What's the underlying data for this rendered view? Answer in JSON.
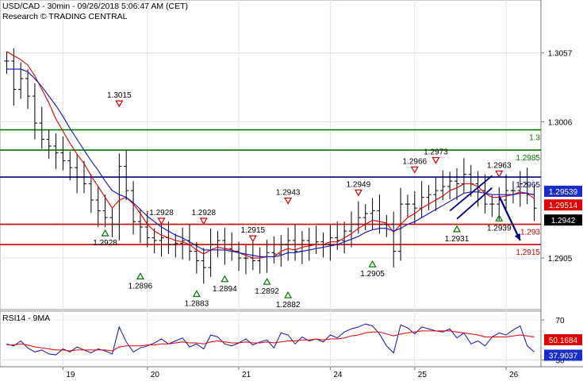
{
  "header": {
    "title": "USD/CAD - 30min - 09/26/2018 5:06:47 AM (CET)",
    "subtitle": "Research © TRADING CENTRAL"
  },
  "colors": {
    "price": "#000000",
    "ma_red": "#e00000",
    "ma_blue": "#1010c0",
    "support": "#cc0000",
    "resistance": "#007700",
    "pivot": "#000080",
    "box_red": "#e00000",
    "box_blue": "#1a2cc8",
    "box_black": "#000000"
  },
  "chart_data": [
    {
      "type": "line",
      "name": "price-panel",
      "ylim": [
        1.2868,
        1.3088
      ],
      "y_ticks": [
        "1.3057",
        "1.3006",
        "1.2905"
      ],
      "y_tick_values": [
        1.3057,
        1.3006,
        1.2905
      ],
      "x_ticks": [
        "19",
        "20",
        "21",
        "24",
        "25",
        "26"
      ],
      "x_tick_index": [
        8,
        20,
        33,
        46,
        58,
        71
      ],
      "n_bars": 76,
      "series": [],
      "close": [
        1.3051,
        1.303,
        1.3038,
        1.3025,
        1.3005,
        1.2993,
        1.2988,
        1.2983,
        1.2977,
        1.2972,
        1.2965,
        1.296,
        1.2948,
        1.294,
        1.2935,
        1.293,
        1.2973,
        1.2955,
        1.2932,
        1.2928,
        1.292,
        1.2918,
        1.292,
        1.2915,
        1.2916,
        1.2918,
        1.291,
        1.2903,
        1.2898,
        1.2915,
        1.2918,
        1.2912,
        1.291,
        1.2905,
        1.2905,
        1.2903,
        1.2906,
        1.2909,
        1.2908,
        1.2915,
        1.2918,
        1.291,
        1.2918,
        1.2915,
        1.2917,
        1.2915,
        1.292,
        1.2918,
        1.2925,
        1.293,
        1.2935,
        1.2938,
        1.294,
        1.293,
        1.293,
        1.291,
        1.2945,
        1.2945,
        1.2942,
        1.295,
        1.2952,
        1.2955,
        1.2958,
        1.2962,
        1.296,
        1.2967,
        1.296,
        1.2955,
        1.2945,
        1.2945,
        1.2948,
        1.2955,
        1.2955,
        1.296,
        1.2952,
        1.2942
      ],
      "ma_red": [
        1.3058,
        1.3055,
        1.3052,
        1.3048,
        1.304,
        1.303,
        1.302,
        1.3008,
        1.2999,
        1.299,
        1.2982,
        1.2975,
        1.2966,
        1.2958,
        1.295,
        1.2942,
        1.2948,
        1.295,
        1.2945,
        1.2938,
        1.293,
        1.2925,
        1.2922,
        1.292,
        1.2918,
        1.2917,
        1.2915,
        1.2911,
        1.2908,
        1.2911,
        1.2913,
        1.2912,
        1.2911,
        1.2909,
        1.2907,
        1.2905,
        1.2905,
        1.2906,
        1.2906,
        1.291,
        1.2912,
        1.2911,
        1.2913,
        1.2914,
        1.2915,
        1.2915,
        1.2917,
        1.2917,
        1.292,
        1.2923,
        1.2927,
        1.293,
        1.2933,
        1.2932,
        1.2931,
        1.2924,
        1.293,
        1.2935,
        1.2938,
        1.2942,
        1.2945,
        1.2948,
        1.2951,
        1.2955,
        1.2957,
        1.296,
        1.296,
        1.2958,
        1.2953,
        1.295,
        1.295,
        1.2951,
        1.2952,
        1.2954,
        1.2953,
        1.2949
      ],
      "ma_blue": [
        1.3045,
        1.3045,
        1.3045,
        1.3043,
        1.3038,
        1.3032,
        1.3025,
        1.3018,
        1.301,
        1.3001,
        1.2993,
        1.2985,
        1.2977,
        1.297,
        1.2962,
        1.2955,
        1.2952,
        1.295,
        1.2946,
        1.2941,
        1.2936,
        1.2932,
        1.2928,
        1.2925,
        1.2922,
        1.292,
        1.2917,
        1.2914,
        1.2911,
        1.2911,
        1.2911,
        1.2911,
        1.291,
        1.2909,
        1.2908,
        1.2907,
        1.2906,
        1.2906,
        1.2906,
        1.2907,
        1.2909,
        1.2909,
        1.291,
        1.2911,
        1.2912,
        1.2913,
        1.2914,
        1.2915,
        1.2917,
        1.2919,
        1.2921,
        1.2924,
        1.2926,
        1.2927,
        1.2927,
        1.2925,
        1.2927,
        1.293,
        1.2932,
        1.2935,
        1.2938,
        1.2941,
        1.2944,
        1.2947,
        1.295,
        1.2953,
        1.2954,
        1.2954,
        1.2953,
        1.2952,
        1.2952,
        1.2952,
        1.2952,
        1.2953,
        1.2953,
        1.2952
      ],
      "levels": [
        {
          "value": 1.2985,
          "label": "1.2985",
          "color": "#007700",
          "kind": "resistance"
        },
        {
          "value": 1.3,
          "label": "1.3",
          "color": "#007700",
          "kind": "resistance"
        },
        {
          "value": 1.2965,
          "label": "1.2965",
          "color": "#000080",
          "kind": "pivot"
        },
        {
          "value": 1.293,
          "label": "1.293",
          "color": "#cc0000",
          "kind": "support"
        },
        {
          "value": 1.2915,
          "label": "1.2915",
          "color": "#cc0000",
          "kind": "support"
        }
      ],
      "price_boxes": [
        {
          "value": 1.29539,
          "label": "1.29539",
          "kind": "blue"
        },
        {
          "value": 1.29514,
          "label": "1.29514",
          "kind": "red"
        },
        {
          "value": 1.2942,
          "label": "1.2942",
          "kind": "black"
        }
      ],
      "markers_high": [
        {
          "i": 16,
          "value": 1.3015,
          "label": "1.3015"
        },
        {
          "i": 22,
          "value": 1.2928,
          "label": "1.2928"
        },
        {
          "i": 28,
          "value": 1.2928,
          "label": "1.2928"
        },
        {
          "i": 35,
          "value": 1.2915,
          "label": "1.2915"
        },
        {
          "i": 40,
          "value": 1.2943,
          "label": "1.2943"
        },
        {
          "i": 50,
          "value": 1.2949,
          "label": "1.2949"
        },
        {
          "i": 58,
          "value": 1.2966,
          "label": "1.2966"
        },
        {
          "i": 61,
          "value": 1.2973,
          "label": "1.2973"
        },
        {
          "i": 70,
          "value": 1.2963,
          "label": "1.2963"
        }
      ],
      "markers_low": [
        {
          "i": 14,
          "value": 1.2928,
          "label": "1.2928"
        },
        {
          "i": 19,
          "value": 1.2896,
          "label": "1.2896"
        },
        {
          "i": 27,
          "value": 1.2883,
          "label": "1.2883"
        },
        {
          "i": 31,
          "value": 1.2894,
          "label": "1.2894"
        },
        {
          "i": 37,
          "value": 1.2892,
          "label": "1.2892"
        },
        {
          "i": 40,
          "value": 1.2882,
          "label": "1.2882"
        },
        {
          "i": 52,
          "value": 1.2905,
          "label": "1.2905"
        },
        {
          "i": 64,
          "value": 1.2931,
          "label": "1.2931"
        },
        {
          "i": 70,
          "value": 1.2939,
          "label": "1.2939"
        }
      ],
      "pattern": {
        "upper": [
          [
            63,
            1.294
          ],
          [
            69,
            1.2966
          ]
        ],
        "lower": [
          [
            64,
            1.2934
          ],
          [
            69,
            1.2957
          ]
        ],
        "arrow_from": [
          70,
          1.2951
        ],
        "arrow_to": [
          73,
          1.2918
        ]
      }
    },
    {
      "type": "line",
      "name": "rsi-panel",
      "title": "RSI14 - 9MA",
      "ylim": [
        24,
        78
      ],
      "y_ticks": [
        "70",
        "30"
      ],
      "y_tick_values": [
        70,
        30
      ],
      "rsi": [
        46,
        44,
        49,
        42,
        38,
        40,
        36,
        35,
        41,
        38,
        43,
        40,
        37,
        41,
        39,
        36,
        63,
        48,
        38,
        42,
        44,
        47,
        51,
        46,
        49,
        52,
        43,
        46,
        41,
        55,
        53,
        46,
        44,
        47,
        51,
        45,
        48,
        50,
        42,
        57,
        55,
        46,
        53,
        49,
        51,
        48,
        55,
        52,
        58,
        61,
        63,
        66,
        64,
        56,
        44,
        37,
        65,
        62,
        56,
        63,
        61,
        59,
        58,
        61,
        52,
        57,
        46,
        49,
        44,
        53,
        57,
        55,
        60,
        64,
        44,
        38
      ],
      "ma": [
        45,
        45,
        46,
        45,
        43,
        42,
        41,
        40,
        40,
        39,
        40,
        40,
        40,
        40,
        40,
        39,
        43,
        44,
        44,
        44,
        45,
        45,
        46,
        46,
        47,
        48,
        47,
        47,
        46,
        48,
        49,
        48,
        47,
        47,
        48,
        47,
        47,
        48,
        47,
        48,
        49,
        49,
        50,
        50,
        51,
        50,
        51,
        51,
        52,
        54,
        55,
        57,
        58,
        58,
        56,
        54,
        56,
        57,
        58,
        59,
        59,
        59,
        59,
        59,
        58,
        57,
        56,
        55,
        53,
        53,
        53,
        53,
        54,
        55,
        54,
        53
      ],
      "price_boxes": [
        {
          "value": 50.1684,
          "label": "50.1684",
          "kind": "red"
        },
        {
          "value": 37.9037,
          "label": "37.9037",
          "kind": "blue"
        }
      ]
    }
  ]
}
